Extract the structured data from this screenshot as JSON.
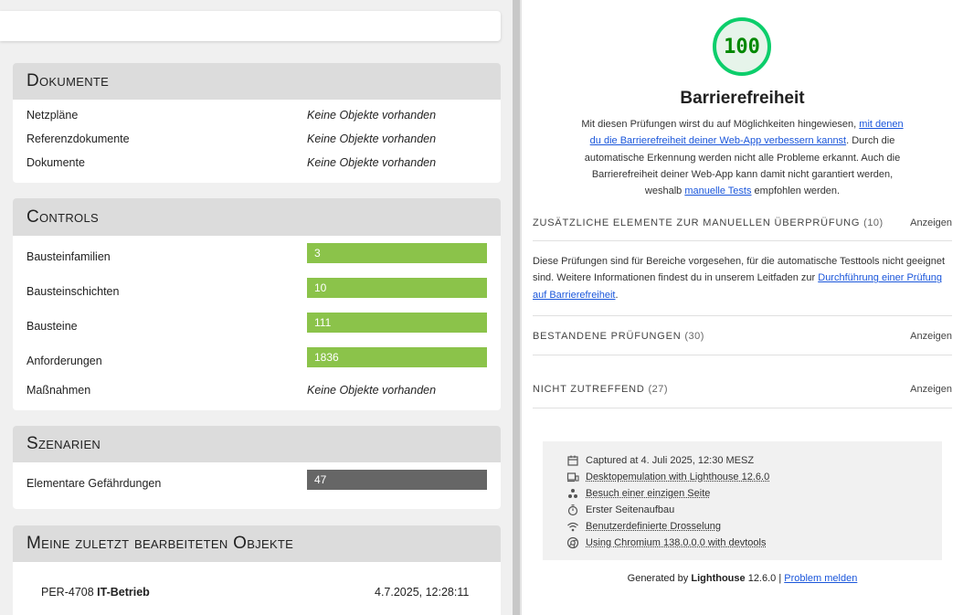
{
  "left": {
    "documents": {
      "title": "Dokumente",
      "rows": [
        {
          "label": "Netzpläne",
          "value": "Keine Objekte vorhanden"
        },
        {
          "label": "Referenzdokumente",
          "value": "Keine Objekte vorhanden"
        },
        {
          "label": "Dokumente",
          "value": "Keine Objekte vorhanden"
        }
      ]
    },
    "controls": {
      "title": "Controls",
      "rows": [
        {
          "label": "Bausteinfamilien",
          "value": "3"
        },
        {
          "label": "Bausteinschichten",
          "value": "10"
        },
        {
          "label": "Bausteine",
          "value": "111"
        },
        {
          "label": "Anforderungen",
          "value": "1836"
        },
        {
          "label": "Maßnahmen",
          "value": "Keine Objekte vorhanden"
        }
      ],
      "bar_color": "#8bc34a"
    },
    "scenarios": {
      "title": "Szenarien",
      "rows": [
        {
          "label": "Elementare Gefährdungen",
          "value": "47"
        }
      ],
      "bar_color": "#666666"
    },
    "recent": {
      "title": "Meine zuletzt bearbeiteten Objekte",
      "rows": [
        {
          "id": "PER-4708",
          "name": "IT-Betrieb",
          "date": "4.7.2025, 12:28:11"
        }
      ]
    }
  },
  "right": {
    "score": "100",
    "score_color": "#0cce6b",
    "category_title": "Barrierefreiheit",
    "description": {
      "part1": "Mit diesen Prüfungen wirst du auf Möglichkeiten hingewiesen, ",
      "link1": "mit denen du die Barrierefreiheit deiner Web-App verbessern kannst",
      "part2": ". Durch die automatische Erkennung werden nicht alle Probleme erkannt. Auch die Barrierefreiheit deiner Web-App kann damit nicht garantiert werden, weshalb ",
      "link2": "manuelle Tests",
      "part3": " empfohlen werden."
    },
    "groups": [
      {
        "title": "Zusätzliche Elemente zur manuellen Überprüfung",
        "count": "(10)",
        "toggle": "Anzeigen"
      },
      {
        "title": "Bestandene Prüfungen",
        "count": "(30)",
        "toggle": "Anzeigen"
      },
      {
        "title": "Nicht zutreffend",
        "count": "(27)",
        "toggle": "Anzeigen"
      }
    ],
    "manual_desc": {
      "text": "Diese Prüfungen sind für Bereiche vorgesehen, für die automatische Testtools nicht geeignet sind. Weitere Informationen findest du in unserem Leitfaden zur ",
      "link": "Durchführung einer Prüfung auf Barrierefreiheit",
      "end": "."
    },
    "runtime": [
      {
        "icon": "calendar-icon",
        "text": "Captured at 4. Juli 2025, 12:30 MESZ"
      },
      {
        "icon": "devices-icon",
        "text": "Desktopemulation with Lighthouse 12.6.0"
      },
      {
        "icon": "single-page-icon",
        "text": "Besuch einer einzigen Seite"
      },
      {
        "icon": "stopwatch-icon",
        "text": "Erster Seitenaufbau"
      },
      {
        "icon": "network-icon",
        "text": "Benutzerdefinierte Drosselung"
      },
      {
        "icon": "chrome-icon",
        "text": "Using Chromium 138.0.0.0 with devtools"
      }
    ],
    "footer": {
      "prefix": "Generated by ",
      "brand": "Lighthouse",
      "version": " 12.6.0 | ",
      "link": "Problem melden"
    }
  }
}
